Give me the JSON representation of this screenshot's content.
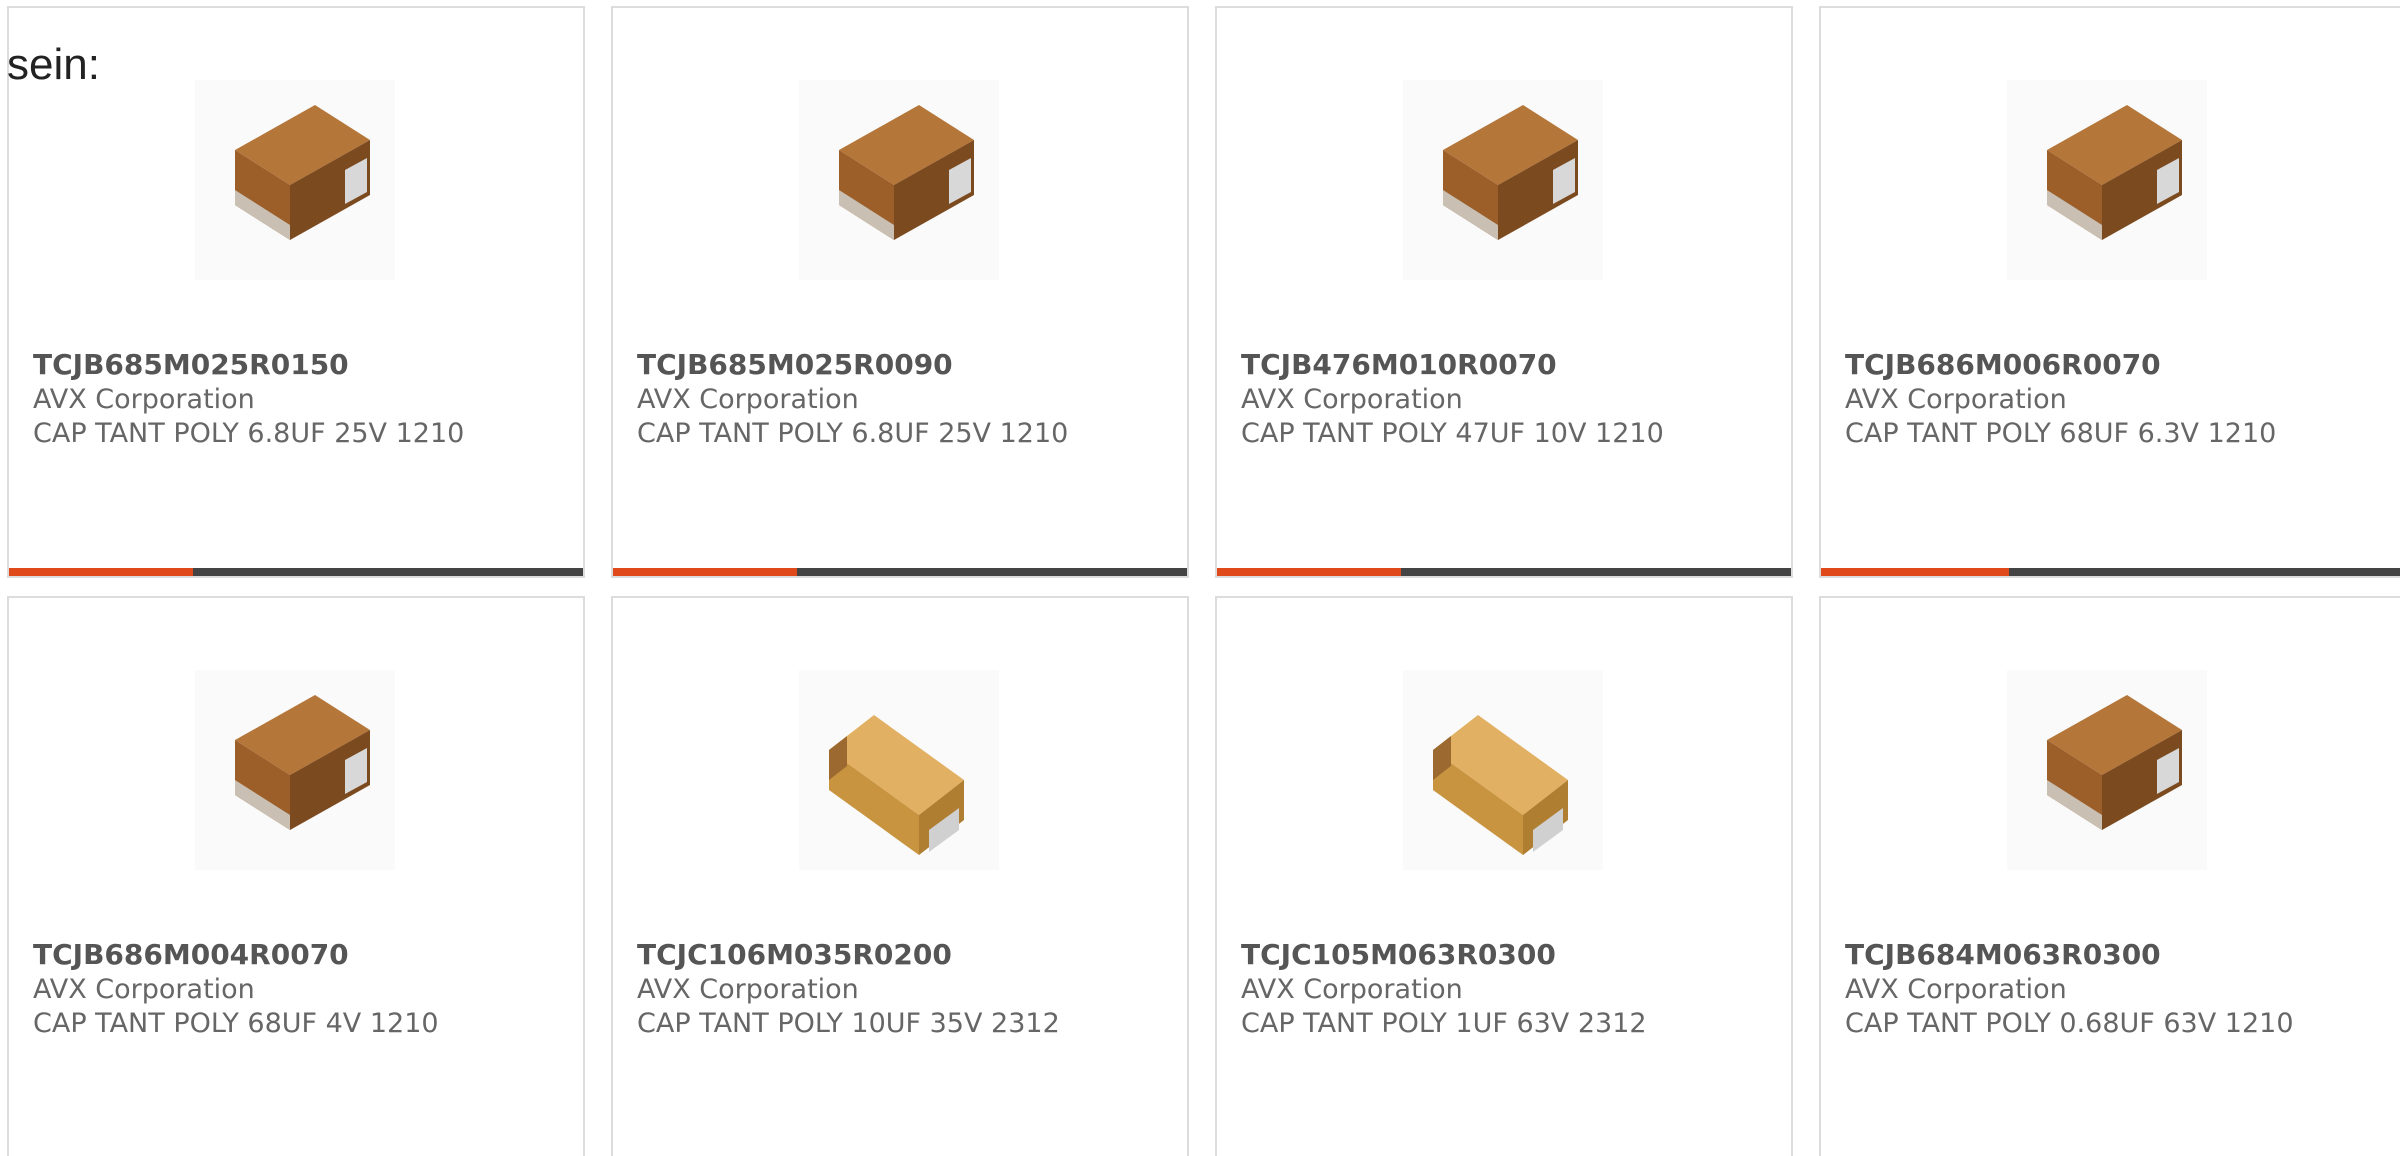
{
  "header_text": "sein:",
  "colors": {
    "accent": "#e04a1a",
    "bar_track": "#444444",
    "card_border": "#dcdcdc",
    "text_strong": "#555555",
    "text": "#666666"
  },
  "products": [
    {
      "part": "TCJB685M025R0150",
      "maker": "AVX Corporation",
      "desc": "CAP TANT POLY 6.8UF 25V 1210",
      "image": "capacitor-brown-icon",
      "progress": 0.32
    },
    {
      "part": "TCJB685M025R0090",
      "maker": "AVX Corporation",
      "desc": "CAP TANT POLY 6.8UF 25V 1210",
      "image": "capacitor-brown-icon",
      "progress": 0.32
    },
    {
      "part": "TCJB476M010R0070",
      "maker": "AVX Corporation",
      "desc": "CAP TANT POLY 47UF 10V 1210",
      "image": "capacitor-brown-icon",
      "progress": 0.32
    },
    {
      "part": "TCJB686M006R0070",
      "maker": "AVX Corporation",
      "desc": "CAP TANT POLY 68UF 6.3V 1210",
      "image": "capacitor-brown-icon",
      "progress": 0.32
    },
    {
      "part": "TCJB686M004R0070",
      "maker": "AVX Corporation",
      "desc": "CAP TANT POLY 68UF 4V 1210",
      "image": "capacitor-brown-icon",
      "progress": null
    },
    {
      "part": "TCJC106M035R0200",
      "maker": "AVX Corporation",
      "desc": "CAP TANT POLY 10UF 35V 2312",
      "image": "capacitor-yellow-icon",
      "progress": null
    },
    {
      "part": "TCJC105M063R0300",
      "maker": "AVX Corporation",
      "desc": "CAP TANT POLY 1UF 63V 2312",
      "image": "capacitor-yellow-icon",
      "progress": null
    },
    {
      "part": "TCJB684M063R0300",
      "maker": "AVX Corporation",
      "desc": "CAP TANT POLY 0.68UF 63V 1210",
      "image": "capacitor-brown-icon",
      "progress": null
    }
  ]
}
